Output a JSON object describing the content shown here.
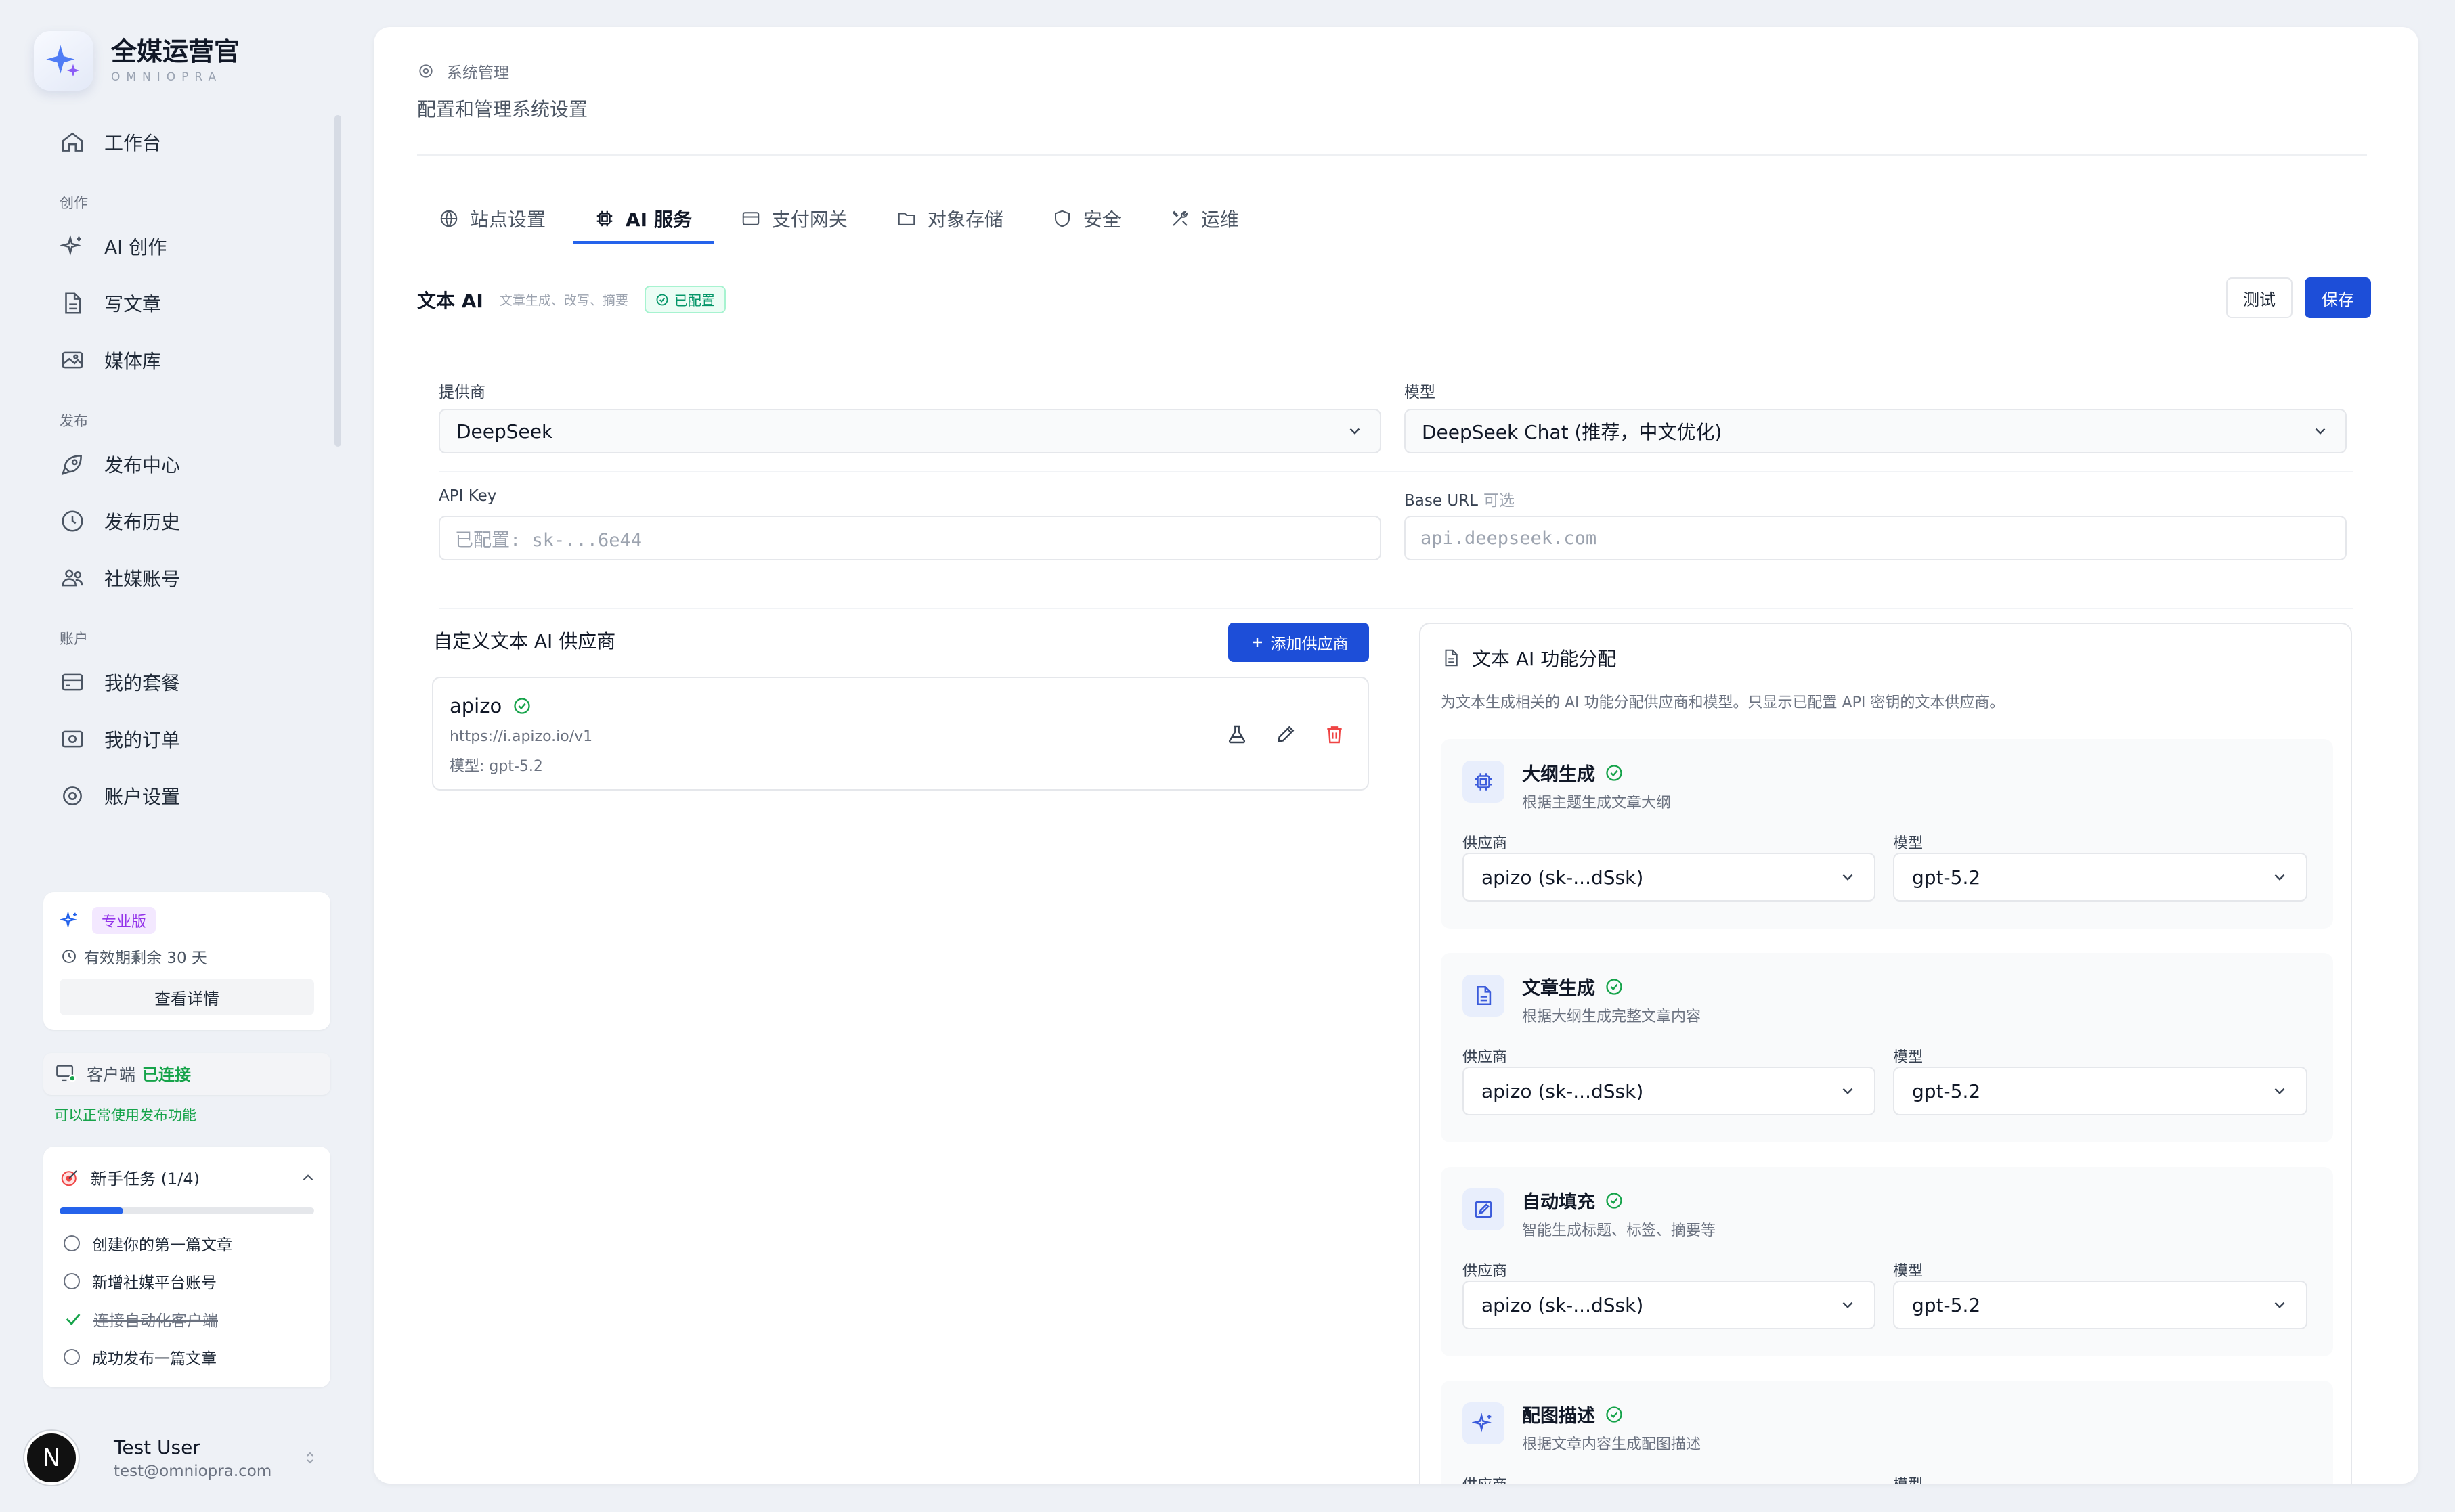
{
  "app": {
    "title": "全媒运营官",
    "subtitle": "OMNIOPRA"
  },
  "nav": {
    "workbench": "工作台",
    "sections": {
      "create": "创作",
      "publish": "发布",
      "account": "账户"
    },
    "items": {
      "ai_create": "AI 创作",
      "write": "写文章",
      "media": "媒体库",
      "publish_center": "发布中心",
      "publish_history": "发布历史",
      "social": "社媒账号",
      "plan": "我的套餐",
      "orders": "我的订单",
      "settings": "账户设置"
    }
  },
  "plan": {
    "badge": "专业版",
    "expiry": "有效期剩余 30 天",
    "details": "查看详情"
  },
  "client": {
    "label": "客户端",
    "status": "已连接",
    "note": "可以正常使用发布功能"
  },
  "tasks": {
    "title": "新手任务 (1/4)",
    "progress": 0.25,
    "items": [
      {
        "label": "创建你的第一篇文章",
        "done": false
      },
      {
        "label": "新增社媒平台账号",
        "done": false
      },
      {
        "label": "连接自动化客户端",
        "done": true
      },
      {
        "label": "成功发布一篇文章",
        "done": false
      }
    ]
  },
  "user": {
    "initial": "N",
    "name": "Test User",
    "email": "test@omniopra.com"
  },
  "page": {
    "breadcrumb": "系统管理",
    "subtitle": "配置和管理系统设置"
  },
  "tabs": [
    "站点设置",
    "AI 服务",
    "支付网关",
    "对象存储",
    "安全",
    "运维"
  ],
  "text_ai": {
    "title": "文本 AI",
    "desc": "文章生成、改写、摘要",
    "status": "已配置",
    "test": "测试",
    "save": "保存",
    "provider_label": "提供商",
    "provider_value": "DeepSeek",
    "model_label": "模型",
    "model_value": "DeepSeek Chat (推荐，中文优化)",
    "apikey_label": "API Key",
    "apikey_placeholder": "已配置: sk-...6e44",
    "baseurl_label": "Base URL",
    "baseurl_optional": "可选",
    "baseurl_placeholder": "api.deepseek.com"
  },
  "custom": {
    "title": "自定义文本 AI 供应商",
    "add": "添加供应商",
    "provider": {
      "name": "apizo",
      "url": "https://i.apizo.io/v1",
      "model": "模型: gpt-5.2"
    }
  },
  "assign": {
    "title": "文本 AI 功能分配",
    "desc": "为文本生成相关的 AI 功能分配供应商和模型。只显示已配置 API 密钥的文本供应商。",
    "provider_label": "供应商",
    "model_label": "模型",
    "functions": [
      {
        "name": "大纲生成",
        "desc": "根据主题生成文章大纲",
        "provider": "apizo (sk-...dSsk)",
        "model": "gpt-5.2"
      },
      {
        "name": "文章生成",
        "desc": "根据大纲生成完整文章内容",
        "provider": "apizo (sk-...dSsk)",
        "model": "gpt-5.2"
      },
      {
        "name": "自动填充",
        "desc": "智能生成标题、标签、摘要等",
        "provider": "apizo (sk-...dSsk)",
        "model": "gpt-5.2"
      },
      {
        "name": "配图描述",
        "desc": "根据文章内容生成配图描述",
        "provider": "",
        "model": ""
      }
    ]
  },
  "colors": {
    "accent": "#2563eb",
    "success": "#16a34a",
    "danger": "#ef4444",
    "pro": "#9333ea"
  }
}
